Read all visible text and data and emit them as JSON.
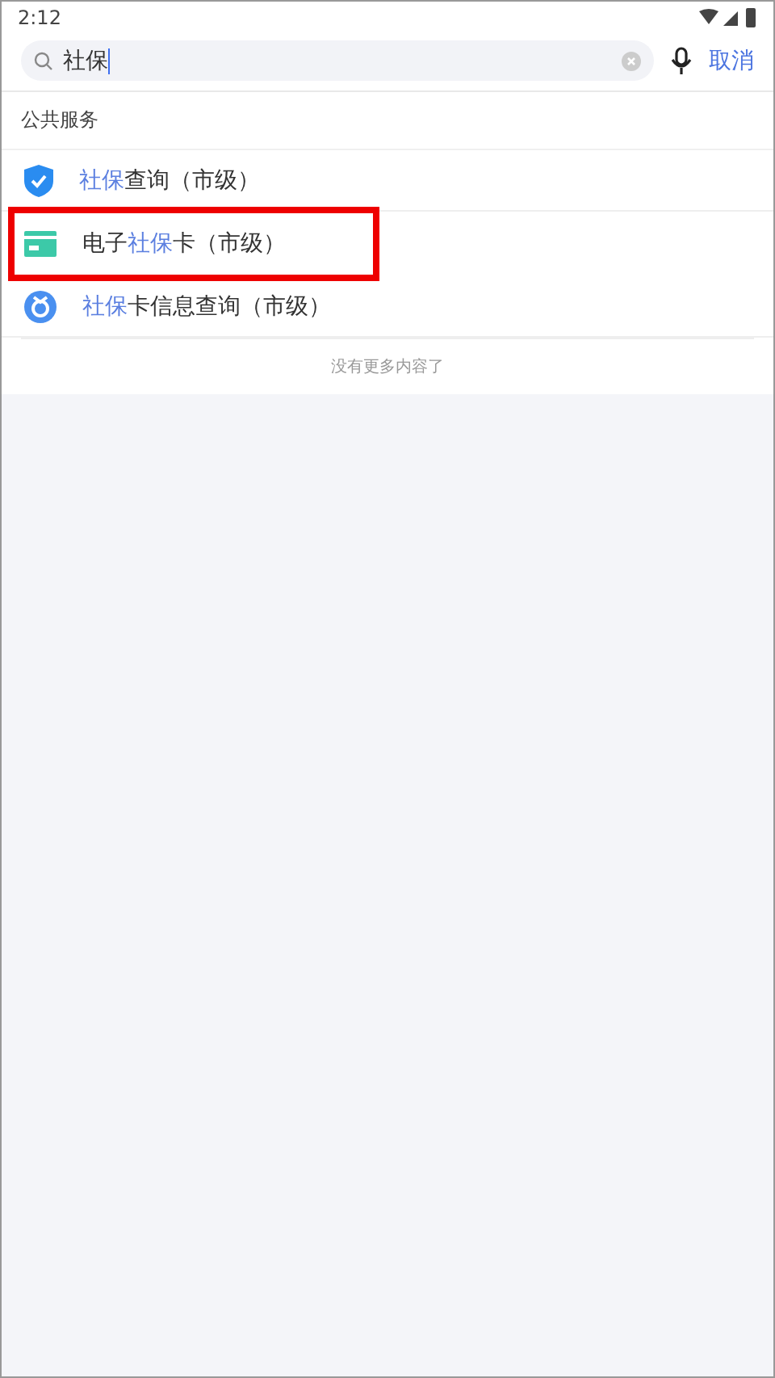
{
  "status_bar": {
    "time": "2:12"
  },
  "search": {
    "value": "社保",
    "cancel": "取消"
  },
  "section": {
    "title": "公共服务"
  },
  "results": [
    {
      "kind": "shield",
      "outlined": false,
      "parts": [
        {
          "text": "社保",
          "highlight": true
        },
        {
          "text": "查询（市级）",
          "highlight": false
        }
      ]
    },
    {
      "kind": "card",
      "outlined": true,
      "parts": [
        {
          "text": "电子",
          "highlight": false
        },
        {
          "text": "社保",
          "highlight": true
        },
        {
          "text": "卡（市级）",
          "highlight": false
        }
      ]
    },
    {
      "kind": "circle",
      "outlined": false,
      "parts": [
        {
          "text": "社保",
          "highlight": true
        },
        {
          "text": "卡信息查询（市级）",
          "highlight": false
        }
      ]
    }
  ],
  "footer": "没有更多内容了"
}
